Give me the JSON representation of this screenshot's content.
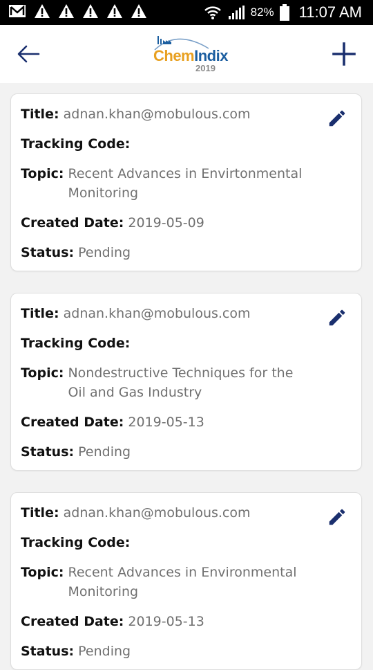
{
  "status_bar": {
    "battery": "82%",
    "time": "11:07 AM"
  },
  "header": {
    "logo_chem": "Chem",
    "logo_indix": "Indix",
    "logo_year": "2019"
  },
  "labels": {
    "title": "Title:",
    "tracking": "Tracking Code:",
    "topic": "Topic:",
    "created": "Created Date:",
    "status": "Status:"
  },
  "cards": [
    {
      "title": "adnan.khan@mobulous.com",
      "tracking_code": "",
      "topic": "Recent Advances in Envirtonmental Monitoring",
      "created_date": "2019-05-09",
      "status": "Pending"
    },
    {
      "title": "adnan.khan@mobulous.com",
      "tracking_code": "",
      "topic": "Nondestructive Techniques for the Oil and Gas Industry",
      "created_date": "2019-05-13",
      "status": "Pending"
    },
    {
      "title": "adnan.khan@mobulous.com",
      "tracking_code": "",
      "topic": "Recent Advances in Environmental Monitoring",
      "created_date": "2019-05-13",
      "status": "Pending"
    }
  ],
  "colors": {
    "accent": "#1a2f6e",
    "logo_orange": "#e8a020",
    "logo_blue": "#1b5ea0"
  },
  "icons": {
    "back": "arrow-left-icon",
    "add": "plus-icon",
    "edit": "pencil-icon"
  }
}
